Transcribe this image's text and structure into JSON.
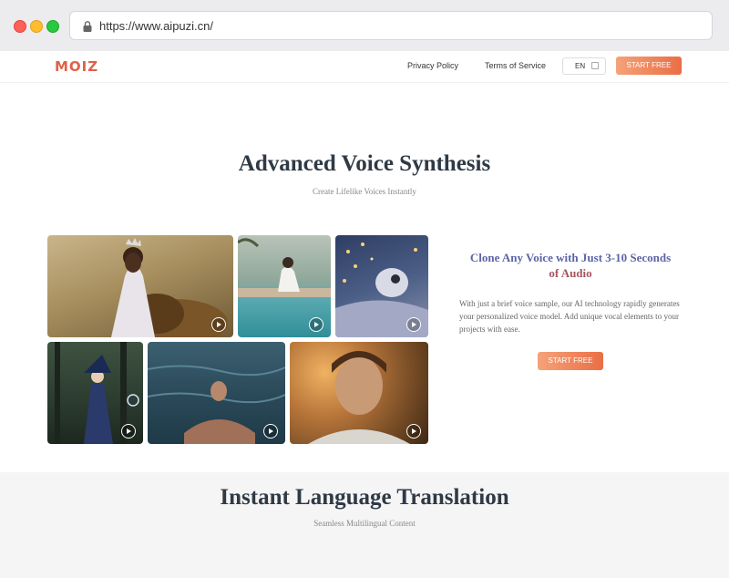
{
  "browser": {
    "url": "https://www.aipuzi.cn/"
  },
  "header": {
    "logo": "MOIZ",
    "nav": {
      "privacy": "Privacy Policy",
      "terms": "Terms of Service"
    },
    "language": "EN",
    "cta": "START FREE"
  },
  "hero": {
    "title": "Advanced Voice Synthesis",
    "subtitle": "Create Lifelike Voices Instantly"
  },
  "gallery": {
    "tiles": [
      "queen-with-lion",
      "woman-by-pool",
      "plush-toy-bedroom",
      "witch-in-forest",
      "man-in-water",
      "woman-portrait"
    ]
  },
  "feature": {
    "title_part1": "Clone Any Voice with Just 3-10 Seconds",
    "title_part2": "of Audio",
    "description": "With just a brief voice sample, our AI technology rapidly generates your personalized voice model. Add unique vocal elements to your projects with ease.",
    "cta": "START FREE"
  },
  "section2": {
    "title": "Instant Language Translation",
    "subtitle": "Seamless Multilingual Content"
  },
  "colors": {
    "accent_start": "#f5a27a",
    "accent_end": "#ea6e44",
    "heading": "#2f3a45"
  }
}
